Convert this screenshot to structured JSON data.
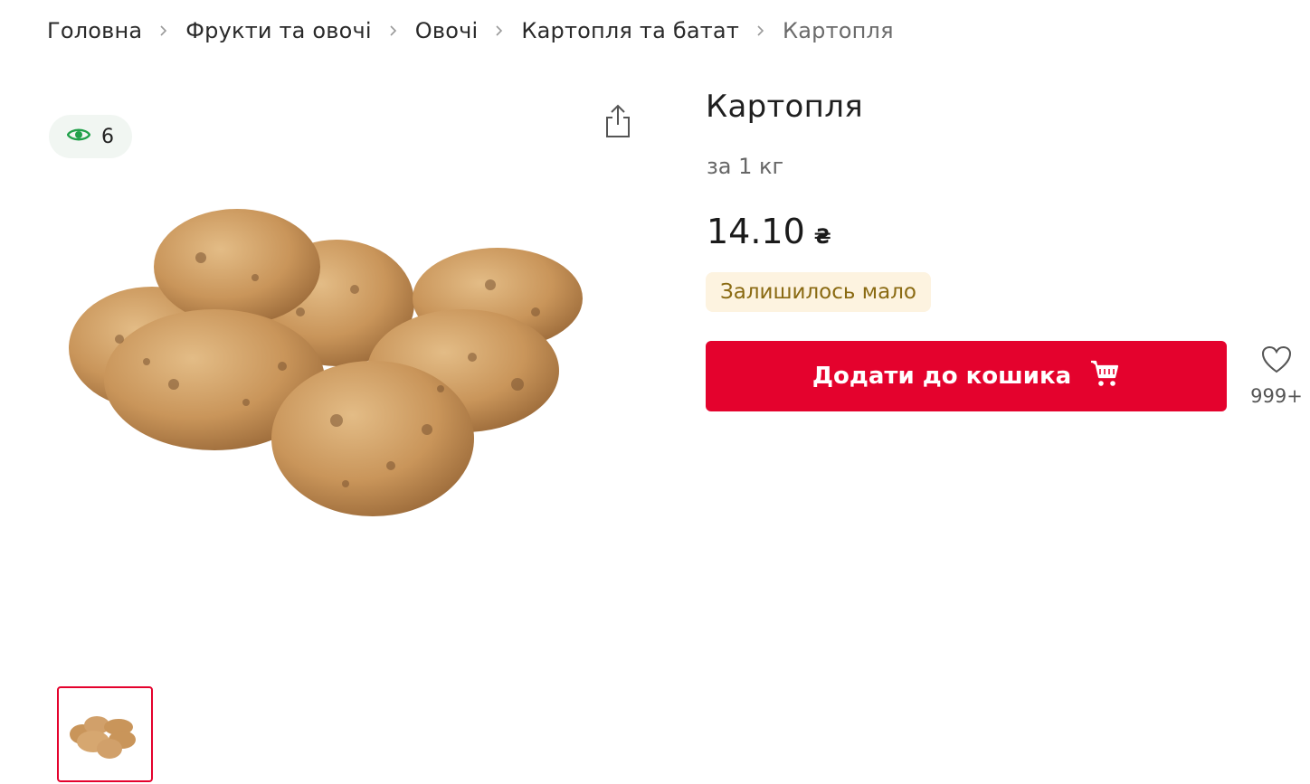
{
  "breadcrumb": {
    "items": [
      {
        "label": "Головна"
      },
      {
        "label": "Фрукти та овочі"
      },
      {
        "label": "Овочі"
      },
      {
        "label": "Картопля та батат"
      },
      {
        "label": "Картопля"
      }
    ]
  },
  "gallery": {
    "views_count": "6",
    "main_image_icon": "potatoes-image",
    "thumbnail_icon": "potatoes-thumbnail"
  },
  "product": {
    "title": "Картопля",
    "unit": "за 1 кг",
    "price": "14.10",
    "currency": "₴",
    "stock_status": "Залишилось мало"
  },
  "actions": {
    "add_to_cart_label": "Додати до кошика",
    "wishlist_count": "999+"
  },
  "colors": {
    "accent": "#e4022d",
    "stock_badge_bg": "#fdf3e0",
    "stock_badge_text": "#8a6a12",
    "views_icon": "#21a04a"
  }
}
